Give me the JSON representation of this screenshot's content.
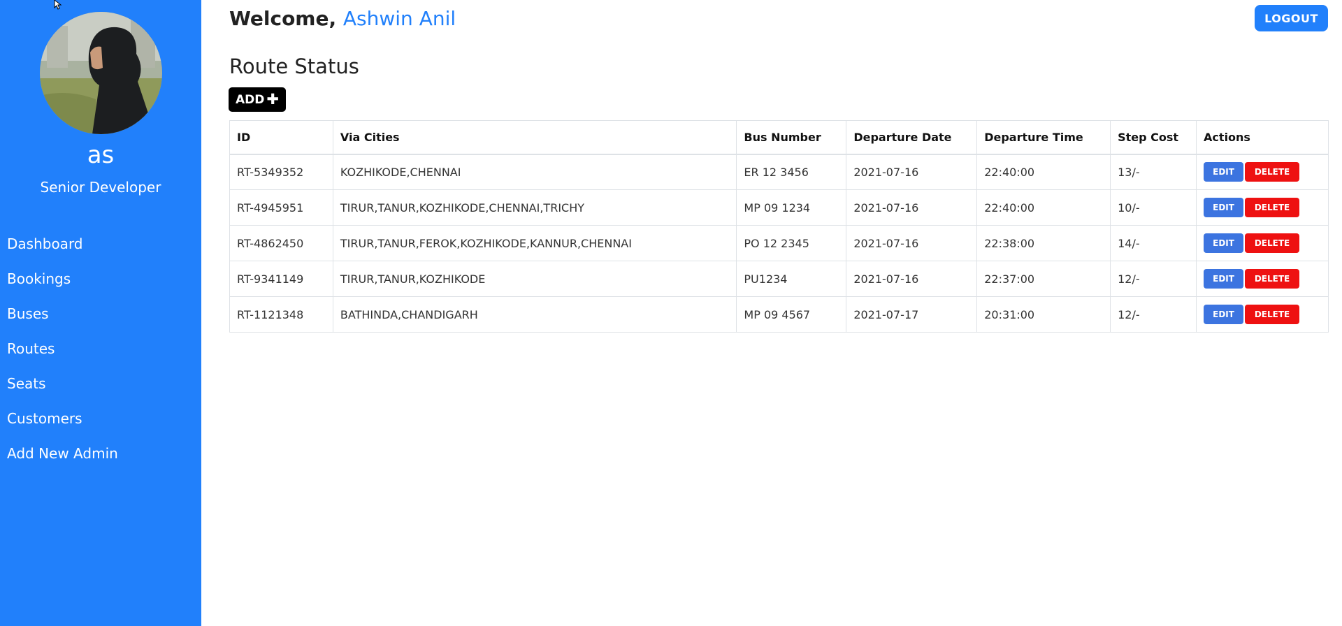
{
  "sidebar": {
    "profile_name": "as",
    "profile_role": "Senior Developer",
    "items": [
      {
        "label": "Dashboard"
      },
      {
        "label": "Bookings"
      },
      {
        "label": "Buses"
      },
      {
        "label": "Routes"
      },
      {
        "label": "Seats"
      },
      {
        "label": "Customers"
      },
      {
        "label": "Add New Admin"
      }
    ]
  },
  "header": {
    "welcome_prefix": "Welcome,",
    "username": "Ashwin Anil",
    "logout_label": "LOGOUT"
  },
  "main": {
    "title": "Route Status",
    "add_label": "ADD",
    "table": {
      "headers": [
        "ID",
        "Via Cities",
        "Bus Number",
        "Departure Date",
        "Departure Time",
        "Step Cost",
        "Actions"
      ],
      "rows": [
        {
          "id": "RT-5349352",
          "via": "KOZHIKODE,CHENNAI",
          "bus": "ER 12 3456",
          "date": "2021-07-16",
          "time": "22:40:00",
          "cost": "13/-"
        },
        {
          "id": "RT-4945951",
          "via": "TIRUR,TANUR,KOZHIKODE,CHENNAI,TRICHY",
          "bus": "MP 09 1234",
          "date": "2021-07-16",
          "time": "22:40:00",
          "cost": "10/-"
        },
        {
          "id": "RT-4862450",
          "via": "TIRUR,TANUR,FEROK,KOZHIKODE,KANNUR,CHENNAI",
          "bus": "PO 12 2345",
          "date": "2021-07-16",
          "time": "22:38:00",
          "cost": "14/-"
        },
        {
          "id": "RT-9341149",
          "via": "TIRUR,TANUR,KOZHIKODE",
          "bus": "PU1234",
          "date": "2021-07-16",
          "time": "22:37:00",
          "cost": "12/-"
        },
        {
          "id": "RT-1121348",
          "via": "BATHINDA,CHANDIGARH",
          "bus": "MP 09 4567",
          "date": "2021-07-17",
          "time": "20:31:00",
          "cost": "12/-"
        }
      ],
      "edit_label": "EDIT",
      "delete_label": "DELETE"
    }
  },
  "colors": {
    "sidebar": "#2180fb",
    "accent": "#2180fb",
    "edit": "#3c74e0",
    "delete": "#ee1111",
    "add": "#000000"
  },
  "icons": {
    "plus": "plus-icon",
    "cursor": "mouse-cursor-icon"
  }
}
